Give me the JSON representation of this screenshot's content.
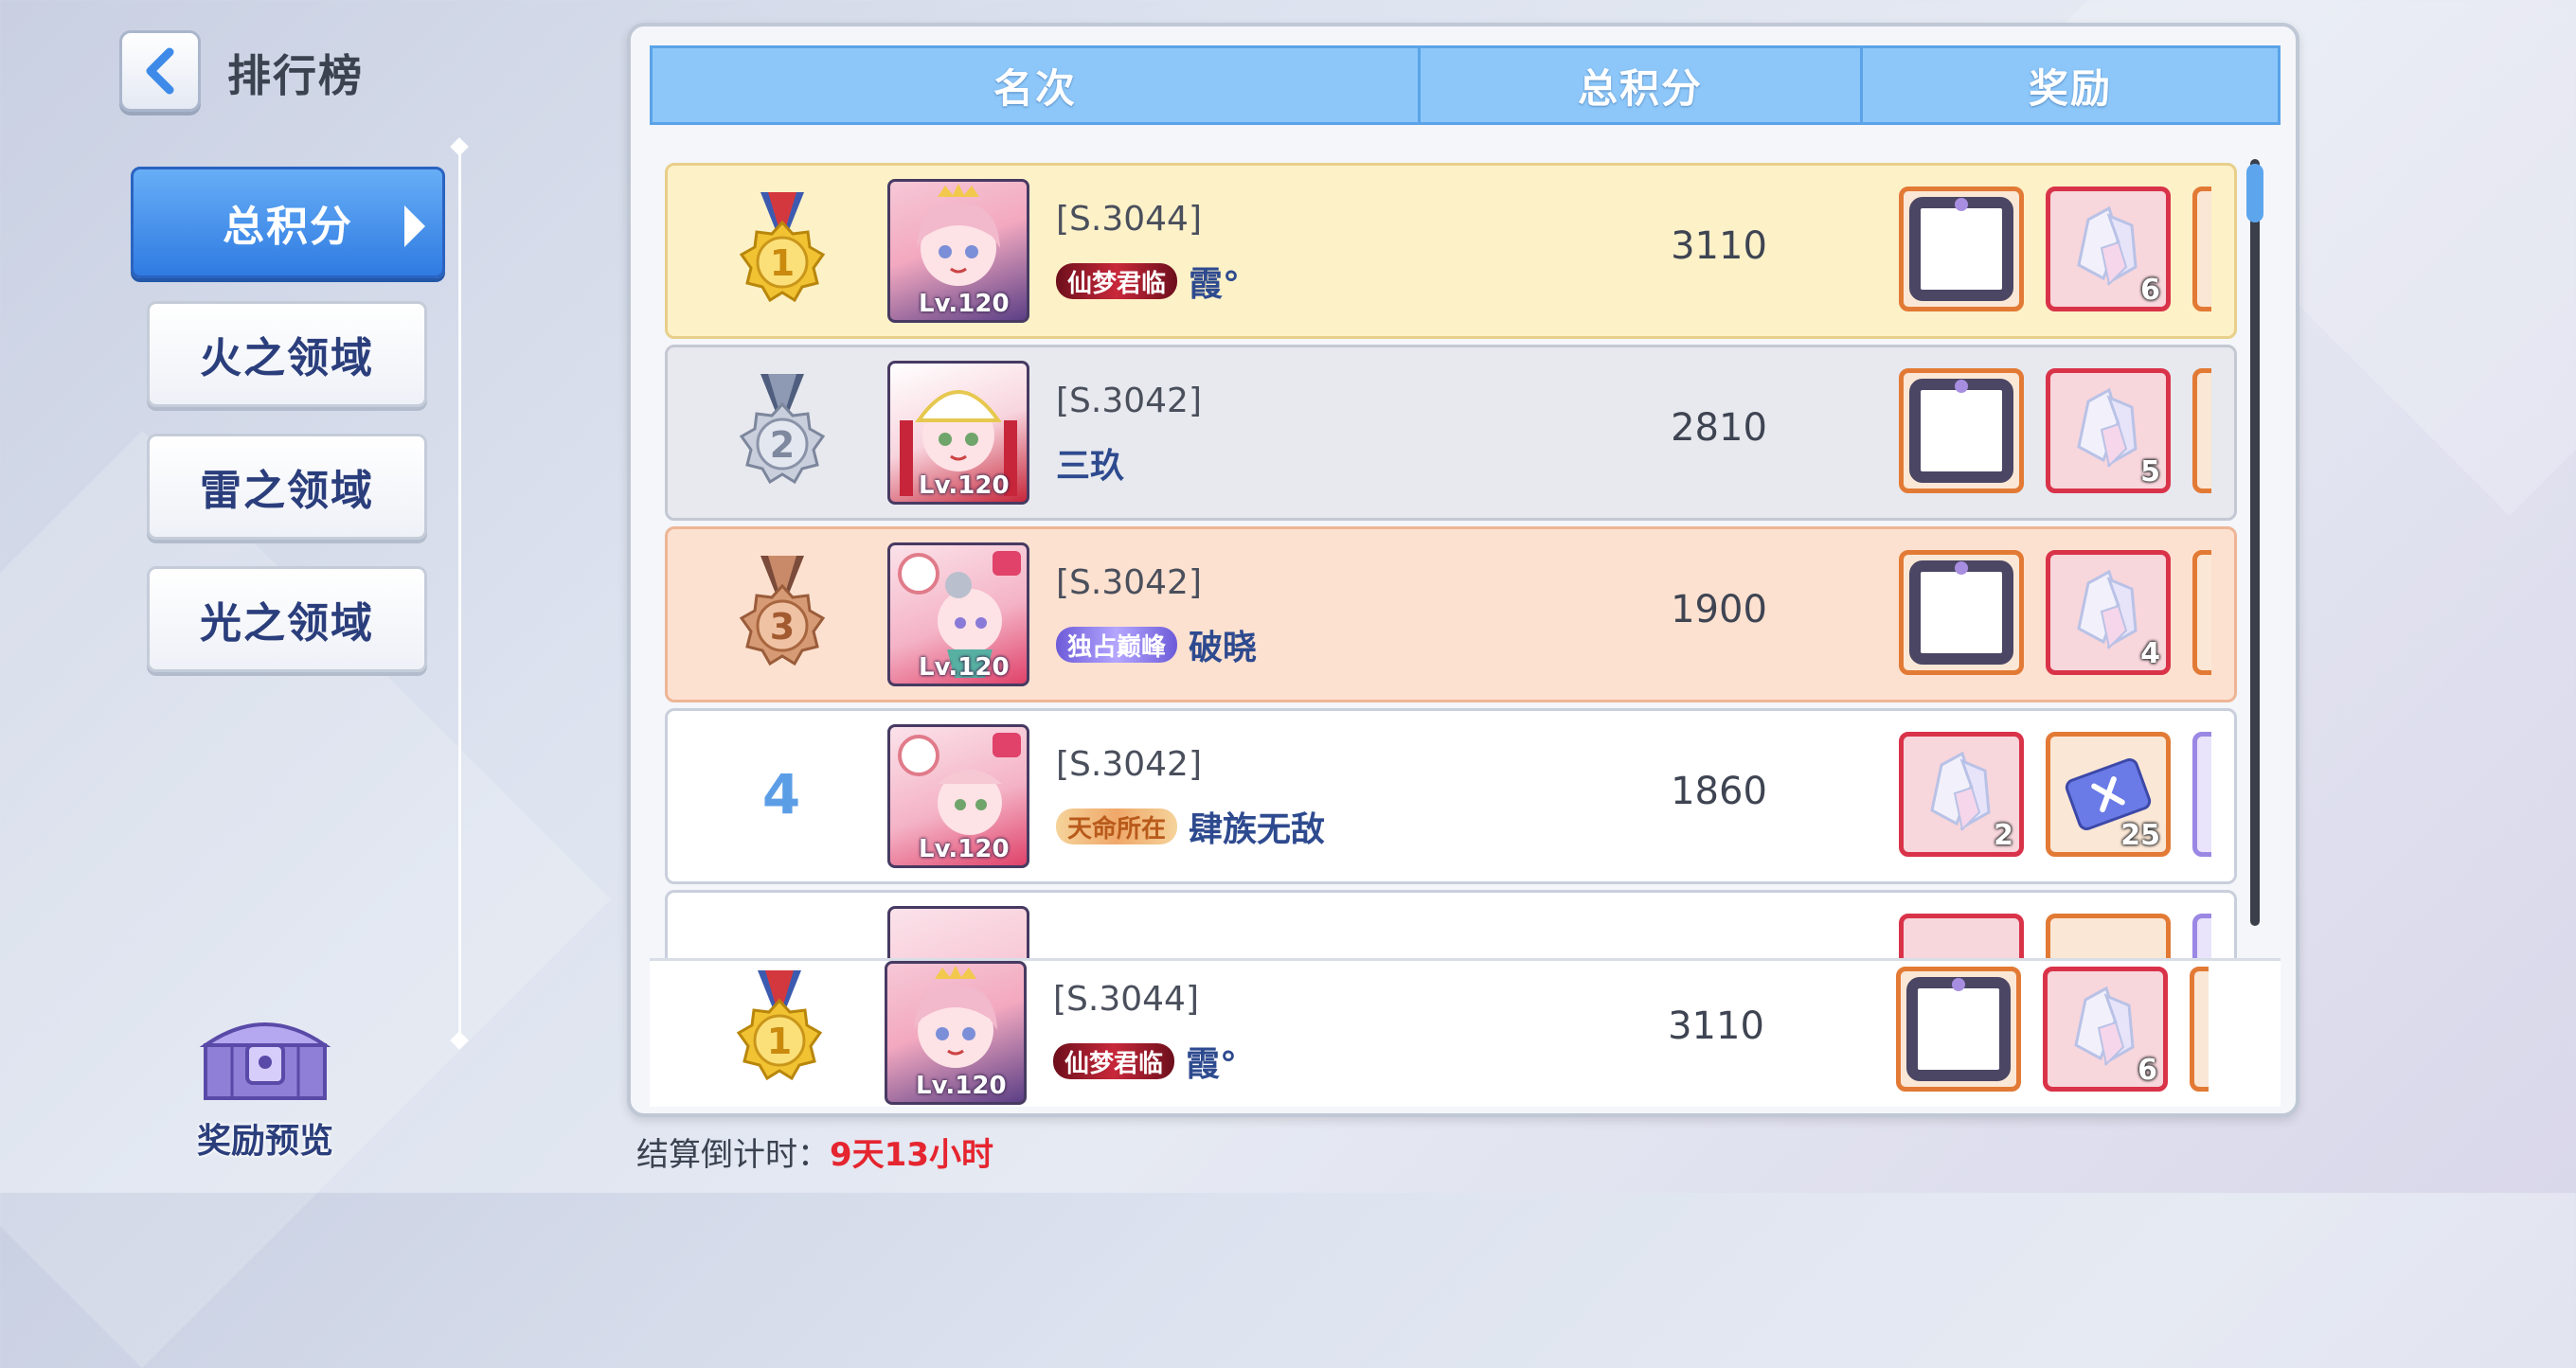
{
  "header": {
    "title": "排行榜"
  },
  "nav": {
    "items": [
      {
        "label": "总积分",
        "active": true
      },
      {
        "label": "火之领域",
        "active": false
      },
      {
        "label": "雷之领域",
        "active": false
      },
      {
        "label": "光之领域",
        "active": false
      }
    ],
    "reward_preview_label": "奖励预览"
  },
  "table": {
    "col_rank": "名次",
    "col_score": "总积分",
    "col_reward": "奖励"
  },
  "rows": [
    {
      "rank": "1",
      "medal": "gold",
      "server": "[S.3044]",
      "title_badge": "仙梦君临",
      "name": "霞°",
      "level": "Lv.120",
      "score": "3110",
      "rewards": [
        {
          "type": "avatar-frame",
          "qty": ""
        },
        {
          "type": "crystal",
          "qty": "6"
        }
      ]
    },
    {
      "rank": "2",
      "medal": "silver",
      "server": "[S.3042]",
      "title_badge": "",
      "name": "三玖",
      "level": "Lv.120",
      "score": "2810",
      "rewards": [
        {
          "type": "avatar-frame",
          "qty": ""
        },
        {
          "type": "crystal",
          "qty": "5"
        }
      ]
    },
    {
      "rank": "3",
      "medal": "bronze",
      "server": "[S.3042]",
      "title_badge": "独占巅峰",
      "name": "破晓",
      "level": "Lv.120",
      "score": "1900",
      "rewards": [
        {
          "type": "avatar-frame",
          "qty": ""
        },
        {
          "type": "crystal",
          "qty": "4"
        }
      ]
    },
    {
      "rank": "4",
      "medal": "",
      "server": "[S.3042]",
      "title_badge": "天命所在",
      "name": "肆族无敌",
      "level": "Lv.120",
      "score": "1860",
      "rewards": [
        {
          "type": "crystal",
          "qty": "2"
        },
        {
          "type": "ticket",
          "qty": "25"
        }
      ]
    }
  ],
  "my_rank": {
    "rank": "1",
    "medal": "gold",
    "server": "[S.3044]",
    "title_badge": "仙梦君临",
    "name": "霞°",
    "level": "Lv.120",
    "score": "3110",
    "rewards": [
      {
        "type": "avatar-frame",
        "qty": ""
      },
      {
        "type": "crystal",
        "qty": "6"
      }
    ]
  },
  "countdown": {
    "label": "结算倒计时：",
    "value": "9天13小时"
  }
}
